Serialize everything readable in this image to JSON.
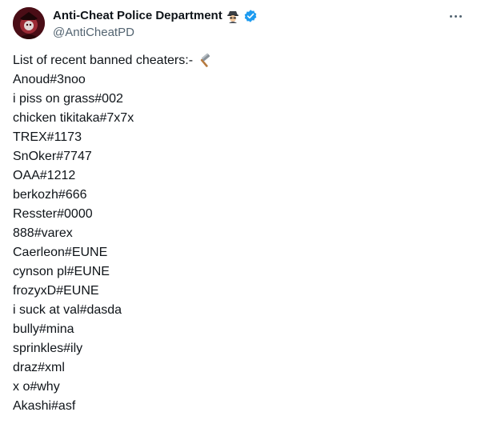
{
  "author": {
    "display_name": "Anti-Cheat Police Department",
    "handle": "@AntiCheatPD",
    "badge_emoji": "detective-icon",
    "verified": true,
    "verified_color": "#1d9bf0"
  },
  "tweet": {
    "intro": "List of recent banned cheaters:-",
    "intro_emoji": "hammer-icon",
    "lines": [
      "Anoud#3noo",
      "i piss on grass#002",
      "chicken tikitaka#7x7x",
      "TREX#1173",
      "SnOker#7747",
      "OAA#1212",
      "berkozh#666",
      "Resster#0000",
      "888#varex",
      "Caerleon#EUNE",
      "cynson pl#EUNE",
      "frozyxD#EUNE",
      "i suck at val#dasda",
      "bully#mina",
      "sprinkles#ily",
      "draz#xml",
      "x o#why",
      "Akashi#asf"
    ]
  },
  "colors": {
    "text": "#0f1419",
    "secondary": "#536471",
    "background": "#ffffff"
  }
}
